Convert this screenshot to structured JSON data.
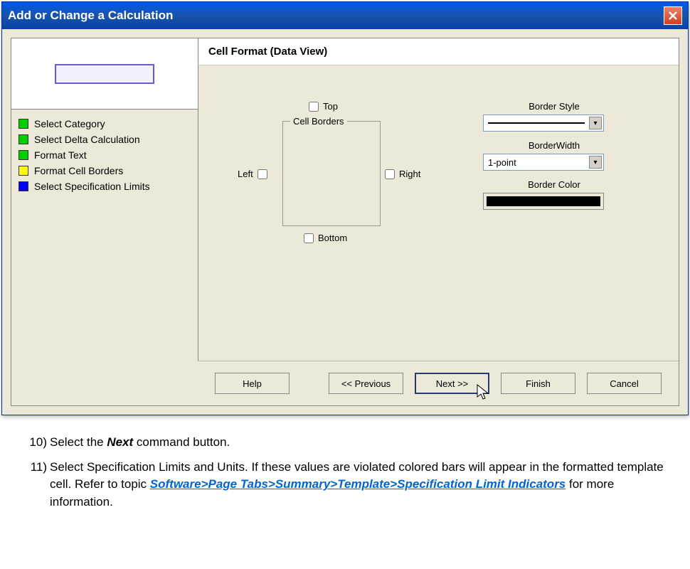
{
  "window": {
    "title": "Add or Change a Calculation"
  },
  "heading": "Cell Format (Data View)",
  "steps": [
    {
      "label": "Select Category",
      "color": "green"
    },
    {
      "label": "Select Delta Calculation",
      "color": "green"
    },
    {
      "label": "Format Text",
      "color": "green"
    },
    {
      "label": "Format Cell Borders",
      "color": "yellow"
    },
    {
      "label": "Select Specification Limits",
      "color": "blue"
    }
  ],
  "borders": {
    "legend": "Cell Borders",
    "top": "Top",
    "left": "Left",
    "right": "Right",
    "bottom": "Bottom"
  },
  "props": {
    "style_label": "Border Style",
    "width_label": "BorderWidth",
    "width_value": "1-point",
    "color_label": "Border Color"
  },
  "buttons": {
    "help": "Help",
    "prev": "<< Previous",
    "next": "Next >>",
    "finish": "Finish",
    "cancel": "Cancel"
  },
  "instructions": {
    "item10_num": "10)",
    "item10_a": "Select the ",
    "item10_b": "Next",
    "item10_c": " command button.",
    "item11_num": "11)",
    "item11_a": "Select Specification Limits and Units. If these values are violated colored bars will appear in the formatted template cell. Refer to   topic ",
    "item11_link": "Software>Page Tabs>Summary>Template>Specification Limit Indicators",
    "item11_c": " for more information."
  }
}
